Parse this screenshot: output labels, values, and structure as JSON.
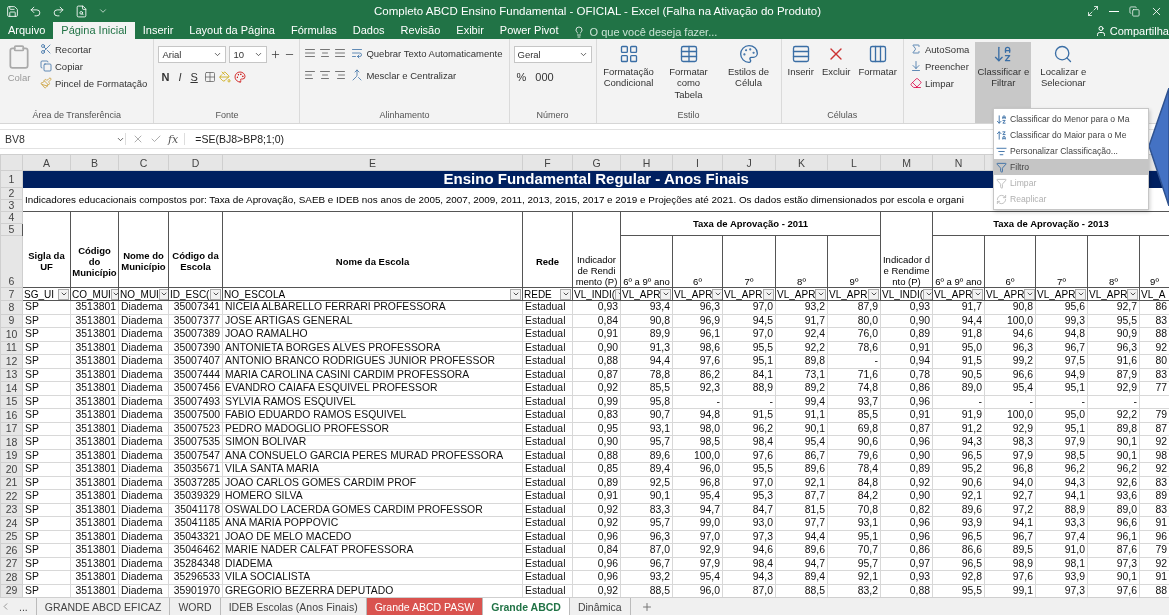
{
  "window": {
    "title": "Completo ABCD Ensino Fundamental - OFICIAL - Excel (Falha na Ativação do Produto)"
  },
  "menu_tabs": [
    {
      "label": "Arquivo",
      "selected": false
    },
    {
      "label": "Página Inicial",
      "selected": true
    },
    {
      "label": "Inserir",
      "selected": false
    },
    {
      "label": "Layout da Página",
      "selected": false
    },
    {
      "label": "Fórmulas",
      "selected": false
    },
    {
      "label": "Dados",
      "selected": false
    },
    {
      "label": "Revisão",
      "selected": false
    },
    {
      "label": "Exibir",
      "selected": false
    },
    {
      "label": "Power Pivot",
      "selected": false
    }
  ],
  "tell_me": {
    "placeholder": "O que você deseja fazer..."
  },
  "share": "Compartilha",
  "ribbon": {
    "clipboard": {
      "label": "Área de Transferência",
      "paste": "Colar",
      "cut": "Recortar",
      "copy": "Copiar",
      "painter": "Pincel de Formatação"
    },
    "font": {
      "label": "Fonte",
      "family": "Arial",
      "size": "10",
      "bold": "N",
      "italic": "I",
      "underline": "S"
    },
    "alignment": {
      "label": "Alinhamento",
      "wrap": "Quebrar Texto Automaticamente",
      "merge": "Mesclar e Centralizar"
    },
    "number": {
      "label": "Número",
      "format": "Geral",
      "percent": "%",
      "thousands": "000"
    },
    "styles": {
      "label": "Estilo",
      "items": [
        "Formatação Condicional",
        "Formatar como Tabela",
        "Estilos de Célula"
      ]
    },
    "cells": {
      "label": "Células",
      "items": [
        "Inserir",
        "Excluir",
        "Formatar"
      ]
    },
    "editing": {
      "small": [
        "AutoSoma",
        "Preencher",
        "Limpar"
      ],
      "large": [
        {
          "label": "Classificar e Filtrar",
          "selected": true
        },
        {
          "label": "Localizar e Selecionar",
          "selected": false
        }
      ]
    }
  },
  "dropdown_menu": [
    {
      "label": "Classificar do Menor para o Ma",
      "selected": false,
      "disabled": false
    },
    {
      "label": "Classificar do Maior para o Me",
      "selected": false,
      "disabled": false
    },
    {
      "label": "Personalizar Classificação...",
      "selected": false,
      "disabled": false
    },
    {
      "label": "Filtro",
      "selected": true,
      "disabled": false
    },
    {
      "label": "Limpar",
      "selected": false,
      "disabled": true
    },
    {
      "label": "Reaplicar",
      "selected": false,
      "disabled": true
    }
  ],
  "formula_bar": {
    "name_box": "BV8",
    "fx": "fx",
    "formula": "=SE(BJ8>BP8;1;0)"
  },
  "sheet": {
    "columns": [
      "A",
      "B",
      "C",
      "D",
      "E",
      "F",
      "G",
      "H",
      "I",
      "J",
      "K",
      "L",
      "M",
      "N"
    ],
    "header_row_numbers": [
      "1",
      "2",
      "3",
      "4",
      "5",
      "6",
      "7"
    ],
    "title": "Ensino Fundamental Regular - Anos Finais",
    "description": "Indicadores educacionais compostos por: Taxa de Aprovação, SAEB e IDEB nos anos de 2005, 2007, 2009, 2011, 2013, 2015, 2017 e 2019 e Projeções até 2021. Os dados estão dimensionados por escola e organi",
    "group_headers": [
      "Taxa de Aprovação - 2011",
      "Taxa de Aprovação - 2013"
    ],
    "headers": [
      "Sigla da UF",
      "Código do Município",
      "Nome do Município",
      "Código da Escola",
      "Nome da Escola",
      "Rede",
      "Indicador de Rendimento (P)",
      "6º a 9º ano",
      "6º",
      "7º",
      "8º",
      "9º",
      "Indicador de Rendimento (P)",
      "6º a 9º ano",
      "6º",
      "7º",
      "8º",
      "9º"
    ],
    "filter_row": [
      "SG_UI",
      "CO_MUI",
      "NO_MUI",
      "ID_ESC(",
      "NO_ESCOLA",
      "REDE",
      "VL_INDI(",
      "VL_APR",
      "VL_APR",
      "VL_APR",
      "VL_APR",
      "VL_APR",
      "VL_INDI(",
      "VL_APR",
      "VL_APR",
      "VL_APR",
      "VL_APR",
      "VL_A"
    ],
    "rows": [
      {
        "number": "8",
        "cells": [
          "SP",
          "3513801",
          "Diadema",
          "35007341",
          "NICEIA ALBARELLO FERRARI PROFESSORA",
          "Estadual",
          "0,93",
          "93,4",
          "96,3",
          "97,0",
          "93,2",
          "87,9",
          "0,93",
          "91,7",
          "90,8",
          "95,6",
          "92,7",
          "86"
        ]
      },
      {
        "number": "9",
        "cells": [
          "SP",
          "3513801",
          "Diadema",
          "35007377",
          "JOSE ARTIGAS GENERAL",
          "Estadual",
          "0,84",
          "90,8",
          "96,9",
          "94,5",
          "91,7",
          "80,0",
          "0,90",
          "94,4",
          "100,0",
          "99,3",
          "95,5",
          "83"
        ]
      },
      {
        "number": "10",
        "cells": [
          "SP",
          "3513801",
          "Diadema",
          "35007389",
          "JOAO RAMALHO",
          "Estadual",
          "0,91",
          "89,9",
          "96,1",
          "97,0",
          "92,4",
          "76,0",
          "0,89",
          "91,8",
          "94,6",
          "94,8",
          "90,9",
          "88"
        ]
      },
      {
        "number": "11",
        "cells": [
          "SP",
          "3513801",
          "Diadema",
          "35007390",
          "ANTONIETA BORGES ALVES PROFESSORA",
          "Estadual",
          "0,90",
          "91,3",
          "98,6",
          "95,5",
          "92,2",
          "78,6",
          "0,91",
          "95,0",
          "96,3",
          "96,7",
          "96,3",
          "92"
        ]
      },
      {
        "number": "12",
        "cells": [
          "SP",
          "3513801",
          "Diadema",
          "35007407",
          "ANTONIO BRANCO RODRIGUES JUNIOR PROFESSOR",
          "Estadual",
          "0,88",
          "94,4",
          "97,6",
          "95,1",
          "89,8",
          "-",
          "0,94",
          "91,5",
          "99,2",
          "97,5",
          "91,6",
          "80"
        ]
      },
      {
        "number": "13",
        "cells": [
          "SP",
          "3513801",
          "Diadema",
          "35007444",
          "MARIA CAROLINA CASINI CARDIM PROFESSORA",
          "Estadual",
          "0,87",
          "78,8",
          "86,2",
          "84,1",
          "73,1",
          "71,6",
          "0,78",
          "90,5",
          "96,6",
          "94,9",
          "87,9",
          "83"
        ]
      },
      {
        "number": "14",
        "cells": [
          "SP",
          "3513801",
          "Diadema",
          "35007456",
          "EVANDRO CAIAFA ESQUIVEL PROFESSOR",
          "Estadual",
          "0,92",
          "85,5",
          "92,3",
          "88,9",
          "89,2",
          "74,8",
          "0,86",
          "89,0",
          "95,4",
          "95,1",
          "92,9",
          "77"
        ]
      },
      {
        "number": "15",
        "cells": [
          "SP",
          "3513801",
          "Diadema",
          "35007493",
          "SYLVIA RAMOS ESQUIVEL",
          "Estadual",
          "0,99",
          "95,8",
          "-",
          "-",
          "99,4",
          "93,7",
          "0,96",
          "-",
          "-",
          "-",
          "-"
        ]
      },
      {
        "number": "16",
        "cells": [
          "SP",
          "3513801",
          "Diadema",
          "35007500",
          "FABIO EDUARDO RAMOS ESQUIVEL",
          "Estadual",
          "0,83",
          "90,7",
          "94,8",
          "91,5",
          "91,1",
          "85,5",
          "0,91",
          "91,9",
          "100,0",
          "95,0",
          "92,2",
          "79"
        ]
      },
      {
        "number": "17",
        "cells": [
          "SP",
          "3513801",
          "Diadema",
          "35007523",
          "PEDRO MADOGLIO PROFESSOR",
          "Estadual",
          "0,95",
          "93,1",
          "98,0",
          "96,2",
          "90,1",
          "69,8",
          "0,87",
          "91,2",
          "92,9",
          "95,1",
          "89,8",
          "87"
        ]
      },
      {
        "number": "18",
        "cells": [
          "SP",
          "3513801",
          "Diadema",
          "35007535",
          "SIMON BOLIVAR",
          "Estadual",
          "0,90",
          "95,7",
          "98,5",
          "98,4",
          "95,4",
          "90,6",
          "0,96",
          "94,3",
          "98,3",
          "97,9",
          "90,1",
          "92"
        ]
      },
      {
        "number": "19",
        "cells": [
          "SP",
          "3513801",
          "Diadema",
          "35007547",
          "ANA CONSUELO GARCIA PERES MURAD PROFESSORA",
          "Estadual",
          "0,88",
          "89,6",
          "100,0",
          "97,6",
          "86,7",
          "79,6",
          "0,90",
          "96,5",
          "97,9",
          "98,5",
          "90,1",
          "98"
        ]
      },
      {
        "number": "20",
        "cells": [
          "SP",
          "3513801",
          "Diadema",
          "35035671",
          "VILA SANTA MARIA",
          "Estadual",
          "0,85",
          "89,4",
          "96,0",
          "95,5",
          "89,6",
          "78,4",
          "0,89",
          "95,2",
          "96,8",
          "96,2",
          "96,2",
          "92"
        ]
      },
      {
        "number": "21",
        "cells": [
          "SP",
          "3513801",
          "Diadema",
          "35037285",
          "JOAO CARLOS GOMES CARDIM PROF",
          "Estadual",
          "0,89",
          "92,5",
          "96,8",
          "97,0",
          "92,1",
          "84,8",
          "0,92",
          "90,6",
          "94,0",
          "94,3",
          "92,6",
          "83"
        ]
      },
      {
        "number": "22",
        "cells": [
          "SP",
          "3513801",
          "Diadema",
          "35039329",
          "HOMERO SILVA",
          "Estadual",
          "0,91",
          "90,1",
          "95,4",
          "95,3",
          "87,7",
          "84,2",
          "0,90",
          "92,1",
          "92,7",
          "94,1",
          "93,6",
          "89"
        ]
      },
      {
        "number": "23",
        "cells": [
          "SP",
          "3513801",
          "Diadema",
          "35041178",
          "OSWALDO LACERDA GOMES CARDIM PROFESSOR",
          "Estadual",
          "0,92",
          "83,3",
          "94,7",
          "84,7",
          "81,5",
          "70,8",
          "0,82",
          "89,6",
          "97,2",
          "88,9",
          "89,0",
          "83"
        ]
      },
      {
        "number": "24",
        "cells": [
          "SP",
          "3513801",
          "Diadema",
          "35041185",
          "ANA MARIA POPPOVIC",
          "Estadual",
          "0,92",
          "95,7",
          "99,0",
          "93,0",
          "97,7",
          "93,1",
          "0,96",
          "93,9",
          "94,1",
          "93,3",
          "96,6",
          "91"
        ]
      },
      {
        "number": "25",
        "cells": [
          "SP",
          "3513801",
          "Diadema",
          "35043321",
          "JOAO DE MELO MACEDO",
          "Estadual",
          "0,96",
          "96,3",
          "97,0",
          "97,3",
          "94,4",
          "95,1",
          "0,96",
          "96,5",
          "96,7",
          "97,4",
          "96,1",
          "96"
        ]
      },
      {
        "number": "26",
        "cells": [
          "SP",
          "3513801",
          "Diadema",
          "35046462",
          "MARIE NADER CALFAT PROFESSORA",
          "Estadual",
          "0,84",
          "87,0",
          "92,9",
          "94,6",
          "89,6",
          "70,7",
          "0,86",
          "86,6",
          "89,5",
          "91,0",
          "87,6",
          "79"
        ]
      },
      {
        "number": "27",
        "cells": [
          "SP",
          "3513801",
          "Diadema",
          "35284348",
          "DIADEMA",
          "Estadual",
          "0,96",
          "96,7",
          "97,9",
          "98,4",
          "94,7",
          "95,7",
          "0,97",
          "96,5",
          "98,9",
          "98,1",
          "97,3",
          "92"
        ]
      },
      {
        "number": "28",
        "cells": [
          "SP",
          "3513801",
          "Diadema",
          "35296533",
          "VILA SOCIALISTA",
          "Estadual",
          "0,96",
          "93,2",
          "95,4",
          "94,3",
          "89,4",
          "92,1",
          "0,93",
          "92,8",
          "97,6",
          "93,9",
          "90,1",
          "91"
        ]
      },
      {
        "number": "29",
        "cells": [
          "SP",
          "3513801",
          "Diadema",
          "35901970",
          "GREGORIO BEZERRA DEPUTADO",
          "Estadual",
          "0,92",
          "88,5",
          "96,0",
          "87,0",
          "88,5",
          "83,2",
          "0,88",
          "95,5",
          "99,1",
          "97,3",
          "97,6",
          "88"
        ]
      }
    ]
  },
  "sheet_tabs": {
    "overflow": "...",
    "tabs": [
      {
        "label": "GRANDE ABCD EFICAZ",
        "selected": false
      },
      {
        "label": "WORD",
        "selected": false
      },
      {
        "label": "IDEB Escolas (Anos Finais)",
        "selected": false
      },
      {
        "label": "Grande ABCD PASW",
        "selected": false,
        "color": "#d9534f"
      },
      {
        "label": "Grande ABCD",
        "selected": true
      },
      {
        "label": "Dinâmica",
        "selected": false
      }
    ]
  }
}
